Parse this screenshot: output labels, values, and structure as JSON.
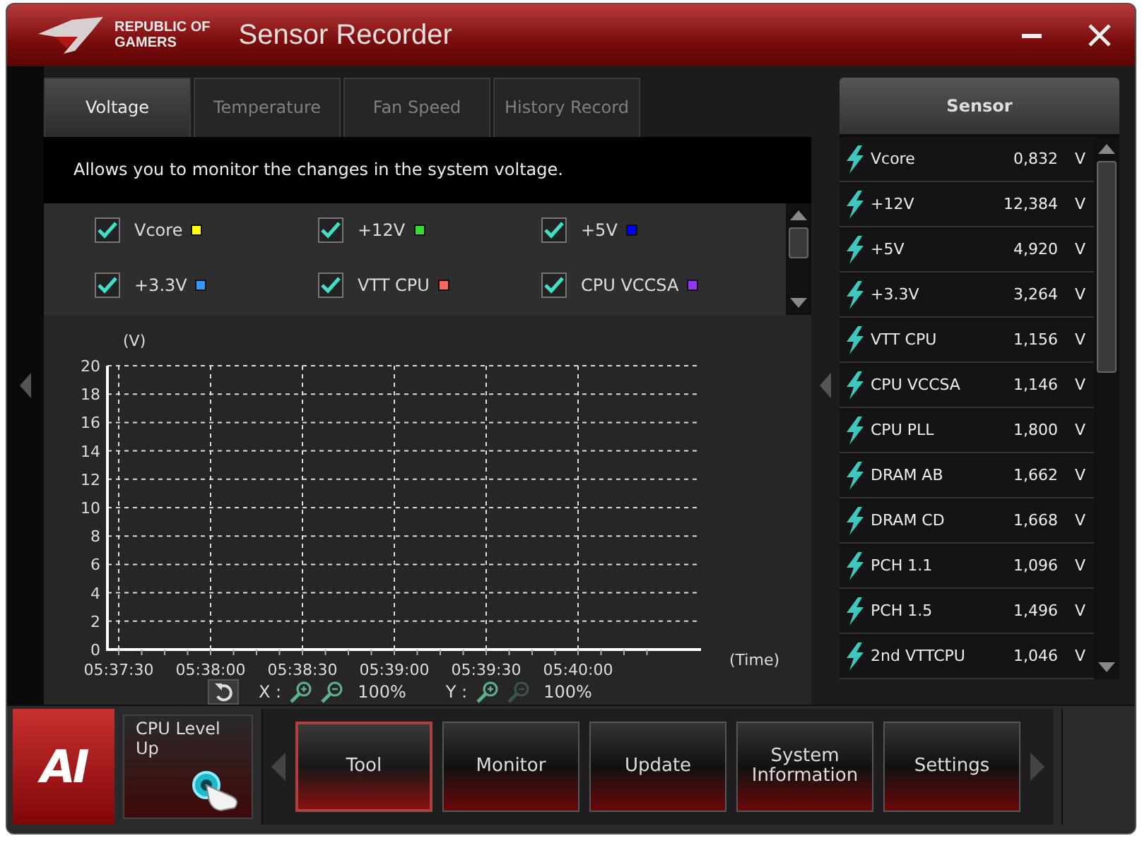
{
  "app": {
    "brand": [
      "REPUBLIC OF",
      "GAMERS"
    ],
    "title": "Sensor Recorder"
  },
  "tabs": [
    {
      "label": "Voltage",
      "selected": true
    },
    {
      "label": "Temperature",
      "selected": false
    },
    {
      "label": "Fan Speed",
      "selected": false
    },
    {
      "label": "History Record",
      "selected": false
    }
  ],
  "description": "Allows you to monitor the changes in the system voltage.",
  "channels": [
    {
      "name": "Vcore",
      "checked": true,
      "color": "#ffff00"
    },
    {
      "name": "+12V",
      "checked": true,
      "color": "#33dd33"
    },
    {
      "name": "+5V",
      "checked": true,
      "color": "#0000ff"
    },
    {
      "name": "+3.3V",
      "checked": true,
      "color": "#3399ff"
    },
    {
      "name": "VTT CPU",
      "checked": true,
      "color": "#ff6655"
    },
    {
      "name": "CPU VCCSA",
      "checked": true,
      "color": "#9933ff"
    }
  ],
  "chart_data": {
    "type": "line",
    "grid": true,
    "xlabel": "(Time)",
    "ylabel": "(V)",
    "ylim": [
      0,
      20
    ],
    "categories": [
      "05:37:30",
      "05:38:00",
      "05:38:30",
      "05:39:00",
      "05:39:30",
      "05:40:00"
    ],
    "yticks": [
      0,
      2,
      4,
      6,
      8,
      10,
      12,
      14,
      16,
      18,
      20
    ]
  },
  "zoom": [
    {
      "axis": "X :",
      "value": "100%",
      "zoom_out_disabled": false
    },
    {
      "axis": "Y :",
      "value": "100%",
      "zoom_out_disabled": true
    }
  ],
  "sensor": {
    "title": "Sensor",
    "rows": [
      {
        "name": "Vcore",
        "value": "0,832",
        "unit": "V"
      },
      {
        "name": "+12V",
        "value": "12,384",
        "unit": "V"
      },
      {
        "name": "+5V",
        "value": "4,920",
        "unit": "V"
      },
      {
        "name": "+3.3V",
        "value": "3,264",
        "unit": "V"
      },
      {
        "name": "VTT CPU",
        "value": "1,156",
        "unit": "V"
      },
      {
        "name": "CPU VCCSA",
        "value": "1,146",
        "unit": "V"
      },
      {
        "name": "CPU PLL",
        "value": "1,800",
        "unit": "V"
      },
      {
        "name": "DRAM AB",
        "value": "1,662",
        "unit": "V"
      },
      {
        "name": "DRAM CD",
        "value": "1,668",
        "unit": "V"
      },
      {
        "name": "PCH 1.1",
        "value": "1,096",
        "unit": "V"
      },
      {
        "name": "PCH 1.5",
        "value": "1,496",
        "unit": "V"
      },
      {
        "name": "2nd VTTCPU",
        "value": "1,046",
        "unit": "V"
      }
    ]
  },
  "dock": {
    "logo": "AI",
    "quick": "CPU Level Up",
    "buttons": [
      {
        "label": "Tool",
        "selected": true
      },
      {
        "label": "Monitor",
        "selected": false
      },
      {
        "label": "Update",
        "selected": false
      },
      {
        "label": "System Information",
        "selected": false
      },
      {
        "label": "Settings",
        "selected": false
      }
    ]
  }
}
